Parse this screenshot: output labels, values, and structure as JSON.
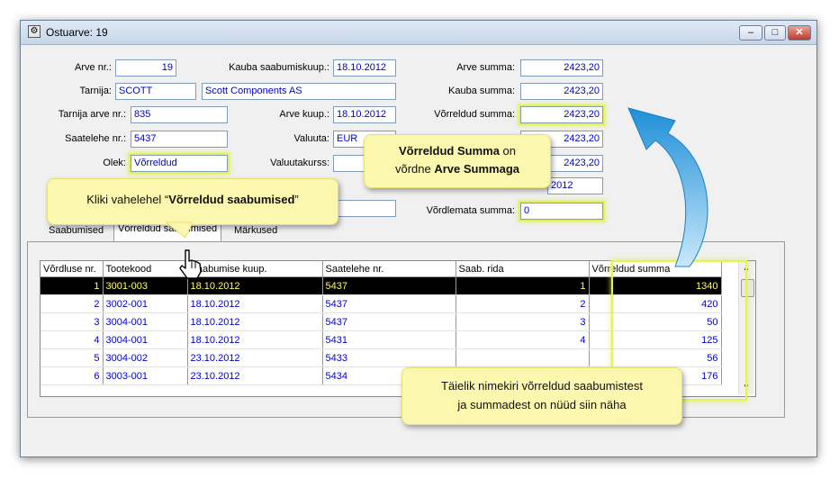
{
  "window": {
    "title": "Ostuarve: 19",
    "minimize_symbol": "–",
    "maximize_symbol": "□",
    "close_symbol": "✕"
  },
  "form": {
    "arve_nr": {
      "label": "Arve nr.:",
      "value": "19"
    },
    "kauba_saabumiskuup": {
      "label": "Kauba saabumiskuup.:",
      "value": "18.10.2012"
    },
    "arve_summa": {
      "label": "Arve summa:",
      "value": "2423,20"
    },
    "tarnija": {
      "label": "Tarnija:",
      "code": "SCOTT",
      "name": "Scott Components AS"
    },
    "kauba_summa": {
      "label": "Kauba summa:",
      "value": "2423,20"
    },
    "tarnija_arve_nr": {
      "label": "Tarnija arve nr.:",
      "value": "835"
    },
    "arve_kuup": {
      "label": "Arve kuup.:",
      "value": "18.10.2012"
    },
    "vorreldud_summa": {
      "label": "Võrreldud summa:",
      "value": "2423,20"
    },
    "saatelehe_nr": {
      "label": "Saatelehe nr.:",
      "value": "5437"
    },
    "valuuta": {
      "label": "Valuuta:",
      "value": "EUR"
    },
    "row4_right": {
      "value": "2423,20"
    },
    "olek": {
      "label": "Olek:",
      "value": "Võrreldud"
    },
    "valuutakurss": {
      "label": "Valuutakurss:",
      "value": ""
    },
    "row5_right": {
      "value": "2423,20"
    },
    "row6_right": {
      "value": "2012"
    },
    "vordlemata_summa": {
      "label": "Võrdlemata summa:",
      "value": "0"
    }
  },
  "tabs": [
    "Saabumised",
    "Võrreldud saabumised",
    "Märkused"
  ],
  "table": {
    "headers": [
      "Võrdluse nr.",
      "Tootekood",
      "Saabumise kuup.",
      "Saatelehe nr.",
      "Saab. rida",
      "Võrreldud summa"
    ],
    "rows": [
      [
        "1",
        "3001-003",
        "18.10.2012",
        "5437",
        "1",
        "1340"
      ],
      [
        "2",
        "3002-001",
        "18.10.2012",
        "5437",
        "2",
        "420"
      ],
      [
        "3",
        "3004-001",
        "18.10.2012",
        "5437",
        "3",
        "50"
      ],
      [
        "4",
        "3004-001",
        "18.10.2012",
        "5431",
        "4",
        "125"
      ],
      [
        "5",
        "3004-002",
        "23.10.2012",
        "5433",
        "",
        "56"
      ],
      [
        "6",
        "3003-001",
        "23.10.2012",
        "5434",
        "",
        "176"
      ]
    ]
  },
  "callouts": {
    "c1_pre": "Kliki vahelehel “",
    "c1_bold": "Võrreldud saabumised",
    "c1_post": "”",
    "c2_bold1": "Võrreldud Summa",
    "c2_mid1": " on",
    "c2_mid2": "võrdne ",
    "c2_bold2": "Arve Summaga",
    "c3_line1": "Täielik nimekiri võrreldud saabumistest",
    "c3_line2": "ja summadest on nüüd siin näha"
  },
  "colors": {
    "value_text": "#0000c8",
    "selected_row_bg": "#000000",
    "selected_row_text": "#ffff64",
    "highlight": "#e6f05a",
    "callout_bg": "#fbf7ae",
    "arrow_blue": "#2a9ae0"
  },
  "icons": [
    "app-icon",
    "cursor-hand-icon",
    "curved-arrow-icon",
    "scroll-up-icon",
    "scroll-down-icon"
  ]
}
